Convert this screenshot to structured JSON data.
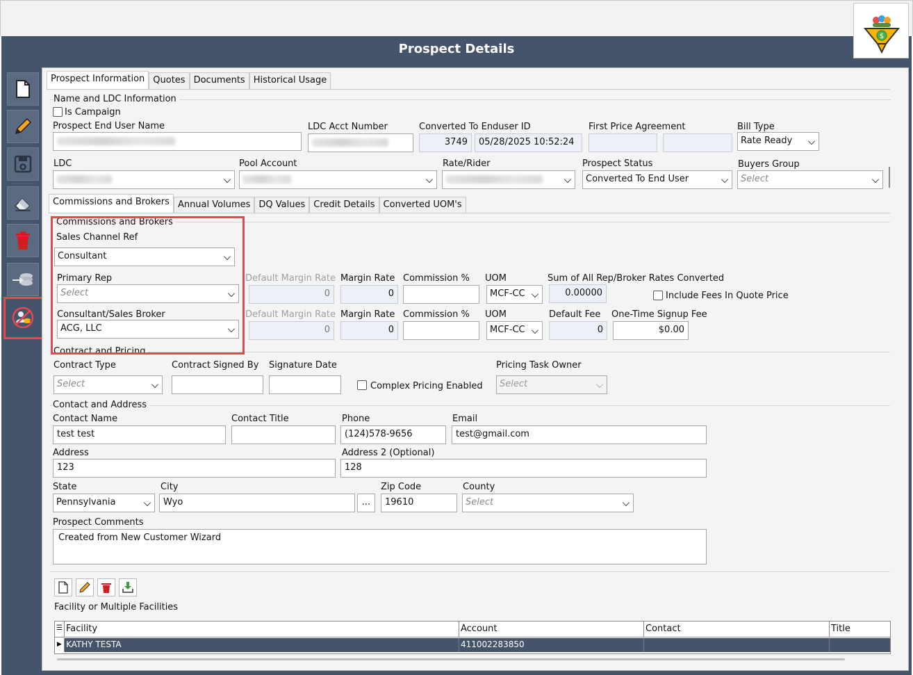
{
  "window": {
    "title": "Prospect Details"
  },
  "toolbar": [
    "new",
    "edit",
    "save",
    "clear",
    "delete",
    "convert",
    "commissions"
  ],
  "tabs": [
    "Prospect Information",
    "Quotes",
    "Documents",
    "Historical Usage"
  ],
  "name_section": {
    "group_label": "Name and LDC Information",
    "is_campaign_label": "Is Campaign",
    "end_user_name_label": "Prospect End User Name",
    "ldc_acct_label": "LDC Acct Number",
    "converted_label": "Converted To Enduser ID",
    "converted_id": "3749",
    "converted_date": "05/28/2025 10:52:24",
    "first_price_label": "First Price Agreement",
    "bill_type_label": "Bill Type",
    "bill_type_value": "Rate Ready",
    "ldc_label": "LDC",
    "pool_label": "Pool Account",
    "rate_label": "Rate/Rider",
    "status_label": "Prospect Status",
    "status_value": "Converted To End User",
    "buyers_label": "Buyers Group",
    "buyers_placeholder": "Select"
  },
  "subtabs": [
    "Commissions and Brokers",
    "Annual Volumes",
    "DQ Values",
    "Credit Details",
    "Converted UOM's"
  ],
  "commissions": {
    "group_label": "Commissions and Brokers",
    "sales_channel_label": "Sales Channel Ref",
    "sales_channel_value": "Consultant",
    "primary_rep_label": "Primary Rep",
    "primary_rep_placeholder": "Select",
    "default_margin_label": "Default Margin Rate",
    "margin_label": "Margin Rate",
    "commission_label": "Commission %",
    "uom_label": "UOM",
    "sum_label": "Sum of All Rep/Broker Rates Converted",
    "rep_default_margin": "0",
    "rep_margin": "0",
    "rep_uom": "MCF-CC",
    "sum_value": "0.00000",
    "include_fees_label": "Include Fees In Quote Price",
    "broker_label": "Consultant/Sales Broker",
    "broker_value": "ACG, LLC",
    "broker_default_margin": "0",
    "broker_margin": "0",
    "broker_uom": "MCF-CC",
    "default_fee_label": "Default Fee",
    "default_fee_value": "0",
    "signup_fee_label": "One-Time Signup Fee",
    "signup_fee_value": "$0.00"
  },
  "contract": {
    "group_label": "Contract and Pricing",
    "type_label": "Contract Type",
    "type_placeholder": "Select",
    "signed_by_label": "Contract Signed By",
    "signature_date_label": "Signature Date",
    "complex_label": "Complex Pricing Enabled",
    "task_owner_label": "Pricing Task Owner",
    "task_owner_placeholder": "Select"
  },
  "contact": {
    "group_label": "Contact and Address",
    "name_label": "Contact Name",
    "name_value": "test test",
    "title_label": "Contact Title",
    "phone_label": "Phone",
    "phone_value": "(124)578-9656",
    "email_label": "Email",
    "email_value": "test@gmail.com",
    "address_label": "Address",
    "address_value": "123",
    "address2_label": "Address 2 (Optional)",
    "address2_value": "128",
    "state_label": "State",
    "state_value": "Pennsylvania",
    "city_label": "City",
    "city_value": "Wyo",
    "ellipsis": "...",
    "zip_label": "Zip Code",
    "zip_value": "19610",
    "county_label": "County",
    "county_placeholder": "Select",
    "comments_label": "Prospect Comments",
    "comments_value": "Created from New Customer Wizard"
  },
  "facilities": {
    "group_label": "Facility or Multiple Facilities",
    "columns": [
      "Facility",
      "Account",
      "Contact",
      "Title"
    ],
    "rows": [
      {
        "facility": "KATHY TESTA",
        "account": "411002283850",
        "contact": "",
        "title": ""
      }
    ]
  },
  "colors": {
    "frame": "#44546a",
    "highlight": "#e8474f"
  }
}
